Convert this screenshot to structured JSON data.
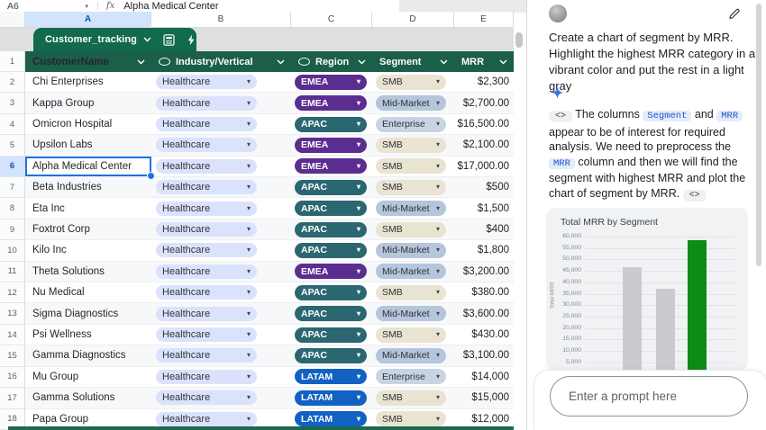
{
  "sheet": {
    "name_box": "A6",
    "fx_label": "fx",
    "formula_value": "Alpha Medical Center",
    "columns": [
      "A",
      "B",
      "C",
      "D",
      "E"
    ],
    "selected_column": "A",
    "selected_row": "6",
    "tab_name": "Customer_tracking"
  },
  "table": {
    "header_row_number": "1",
    "headers": [
      {
        "label": "CustomerName",
        "oval_icon": false
      },
      {
        "label": "Industry/Vertical",
        "oval_icon": true
      },
      {
        "label": "Region",
        "oval_icon": true
      },
      {
        "label": "Segment",
        "oval_icon": false
      },
      {
        "label": "MRR",
        "oval_icon": false
      }
    ],
    "rows": [
      {
        "n": "2",
        "name": "Chi Enterprises",
        "industry": "Healthcare",
        "region": "EMEA",
        "segment": "SMB",
        "mrr": "$2,300"
      },
      {
        "n": "3",
        "name": "Kappa Group",
        "industry": "Healthcare",
        "region": "EMEA",
        "segment": "Mid-Market",
        "mrr": "$2,700.00"
      },
      {
        "n": "4",
        "name": "Omicron Hospital",
        "industry": "Healthcare",
        "region": "APAC",
        "segment": "Enterprise",
        "mrr": "$16,500.00"
      },
      {
        "n": "5",
        "name": "Upsilon Labs",
        "industry": "Healthcare",
        "region": "EMEA",
        "segment": "SMB",
        "mrr": "$2,100.00"
      },
      {
        "n": "6",
        "name": "Alpha Medical Center",
        "industry": "Healthcare",
        "region": "EMEA",
        "segment": "SMB",
        "mrr": "$17,000.00",
        "selected": true
      },
      {
        "n": "7",
        "name": "Beta Industries",
        "industry": "Healthcare",
        "region": "APAC",
        "segment": "SMB",
        "mrr": "$500"
      },
      {
        "n": "8",
        "name": "Eta Inc",
        "industry": "Healthcare",
        "region": "APAC",
        "segment": "Mid-Market",
        "mrr": "$1,500"
      },
      {
        "n": "9",
        "name": "Foxtrot Corp",
        "industry": "Healthcare",
        "region": "APAC",
        "segment": "SMB",
        "mrr": "$400"
      },
      {
        "n": "10",
        "name": "Kilo Inc",
        "industry": "Healthcare",
        "region": "APAC",
        "segment": "Mid-Market",
        "mrr": "$1,800"
      },
      {
        "n": "11",
        "name": "Theta Solutions",
        "industry": "Healthcare",
        "region": "EMEA",
        "segment": "Mid-Market",
        "mrr": "$3,200.00"
      },
      {
        "n": "12",
        "name": "Nu Medical",
        "industry": "Healthcare",
        "region": "APAC",
        "segment": "SMB",
        "mrr": "$380.00"
      },
      {
        "n": "13",
        "name": "Sigma Diagnostics",
        "industry": "Healthcare",
        "region": "APAC",
        "segment": "Mid-Market",
        "mrr": "$3,600.00"
      },
      {
        "n": "14",
        "name": "Psi Wellness",
        "industry": "Healthcare",
        "region": "APAC",
        "segment": "SMB",
        "mrr": "$430.00"
      },
      {
        "n": "15",
        "name": "Gamma Diagnostics",
        "industry": "Healthcare",
        "region": "APAC",
        "segment": "Mid-Market",
        "mrr": "$3,100.00"
      },
      {
        "n": "16",
        "name": "Mu Group",
        "industry": "Healthcare",
        "region": "LATAM",
        "segment": "Enterprise",
        "mrr": "$14,000"
      },
      {
        "n": "17",
        "name": "Gamma Solutions",
        "industry": "Healthcare",
        "region": "LATAM",
        "segment": "SMB",
        "mrr": "$15,000"
      },
      {
        "n": "18",
        "name": "Papa Group",
        "industry": "Healthcare",
        "region": "LATAM",
        "segment": "SMB",
        "mrr": "$12,000"
      }
    ]
  },
  "colors": {
    "header_green": "#1b5e4a",
    "tab_green": "#11694e",
    "selection_blue": "#1a73e8",
    "industry_pill": "#dbe2fc",
    "region": {
      "EMEA": "#5b2d90",
      "APAC": "#2b6770",
      "LATAM": "#1262c4"
    },
    "segment": {
      "SMB": "#e9e3d2",
      "Mid-Market": "#b5c5dc",
      "Enterprise": "#c9d4e3"
    }
  },
  "chat": {
    "user_message": "Create a chart of segment by MRR. Highlight the highest MRR category in a vibrant color and put the rest in a light gray",
    "ai_parts": [
      {
        "t": "chip",
        "v": "<>"
      },
      {
        "t": "text",
        "v": "  The columns "
      },
      {
        "t": "code",
        "v": "Segment"
      },
      {
        "t": "text",
        "v": " and "
      },
      {
        "t": "code",
        "v": "MRR"
      },
      {
        "t": "text",
        "v": " appear to be of interest for required analysis. We need to preprocess the "
      },
      {
        "t": "code",
        "v": "MRR"
      },
      {
        "t": "text",
        "v": " column and then we will find the segment with highest MRR and plot the chart of segment by MRR.  "
      },
      {
        "t": "chip",
        "v": "<>"
      }
    ],
    "prompt_placeholder": "Enter a prompt here"
  },
  "chart_data": {
    "type": "bar",
    "title": "Total MRR by Segment",
    "ylabel": "Total MRR",
    "y_ticks": [
      60000,
      55000,
      50000,
      45000,
      40000,
      35000,
      30000,
      25000,
      20000,
      15000,
      10000,
      5000
    ],
    "ylim_visible": [
      5000,
      60000
    ],
    "grid": true,
    "bars": [
      {
        "category": "",
        "value": 46500,
        "color": "#c9cbce"
      },
      {
        "category": "",
        "value": 37000,
        "color": "#c9cbce"
      },
      {
        "category": "",
        "value": 58500,
        "color": "#0e8b12"
      }
    ],
    "note": "x-axis category labels are cut off behind the prompt box; highest bar is highlighted green"
  }
}
